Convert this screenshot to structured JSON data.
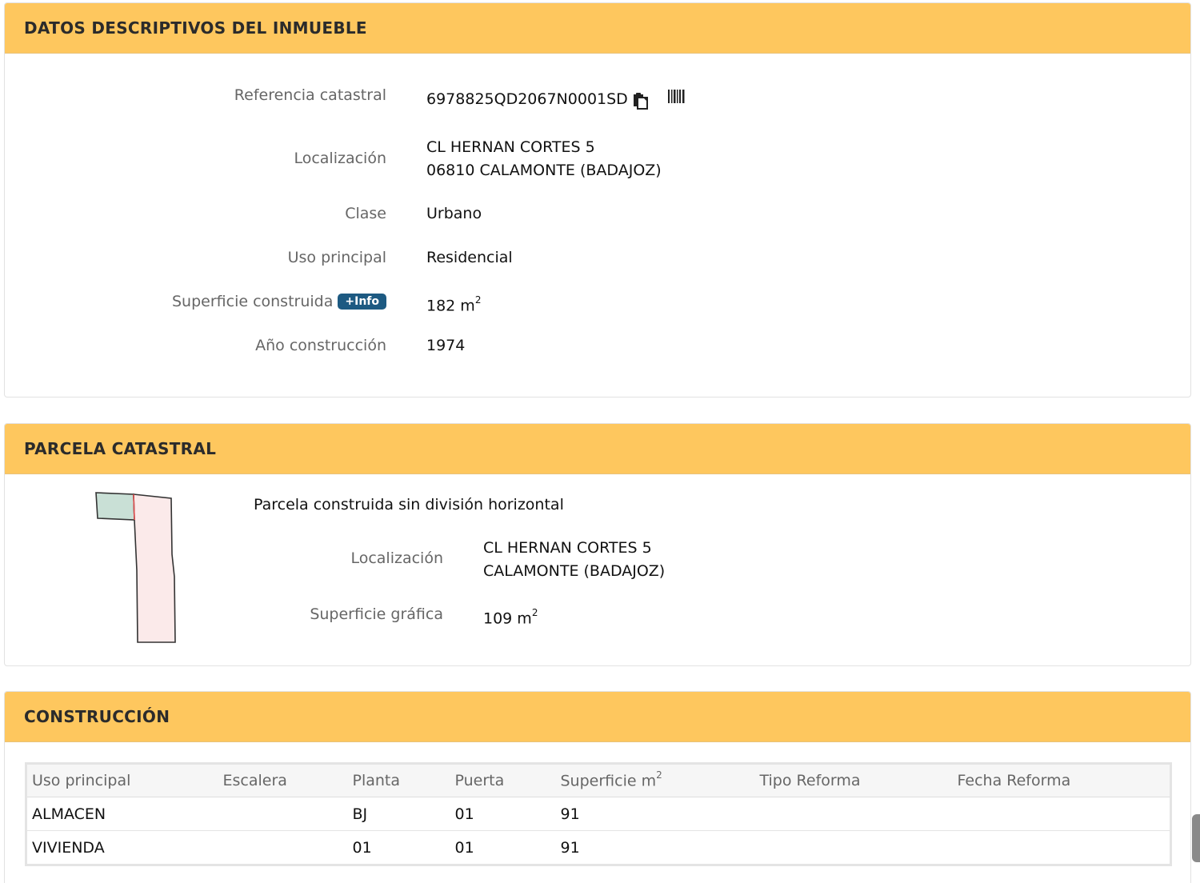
{
  "inmueble": {
    "title": "DATOS DESCRIPTIVOS DEL INMUEBLE",
    "ref_label": "Referencia catastral",
    "ref_value": "6978825QD2067N0001SD",
    "loc_label": "Localización",
    "loc_line1": "CL HERNAN CORTES 5",
    "loc_line2": "06810 CALAMONTE (BADAJOZ)",
    "clase_label": "Clase",
    "clase_value": "Urbano",
    "uso_label": "Uso principal",
    "uso_value": "Residencial",
    "sup_label": "Superficie construida",
    "info_badge": "+Info",
    "sup_value": "182 m",
    "sup_exp": "2",
    "anio_label": "Año construcción",
    "anio_value": "1974",
    "icons": [
      "copy-icon",
      "barcode-icon"
    ]
  },
  "parcela": {
    "title": "PARCELA CATASTRAL",
    "desc": "Parcela construida sin división horizontal",
    "loc_label": "Localización",
    "loc_line1": "CL HERNAN CORTES 5",
    "loc_line2": "CALAMONTE (BADAJOZ)",
    "sup_label": "Superficie gráfica",
    "sup_value": "109 m",
    "sup_exp": "2",
    "map_colors": {
      "main_fill": "#fbeaea",
      "annex_fill": "#c9e0d6",
      "boundary": "#e05050"
    }
  },
  "construccion": {
    "title": "CONSTRUCCIÓN",
    "headers": [
      "Uso principal",
      "Escalera",
      "Planta",
      "Puerta",
      "Superficie m",
      "Tipo Reforma",
      "Fecha Reforma"
    ],
    "sup_header_exp": "2",
    "rows": [
      [
        "ALMACEN",
        "",
        "BJ",
        "01",
        "91",
        "",
        ""
      ],
      [
        "VIVIENDA",
        "",
        "01",
        "01",
        "91",
        "",
        ""
      ]
    ]
  },
  "colors": {
    "header_bg": "#fec75e",
    "badge_bg": "#1d5a82"
  }
}
